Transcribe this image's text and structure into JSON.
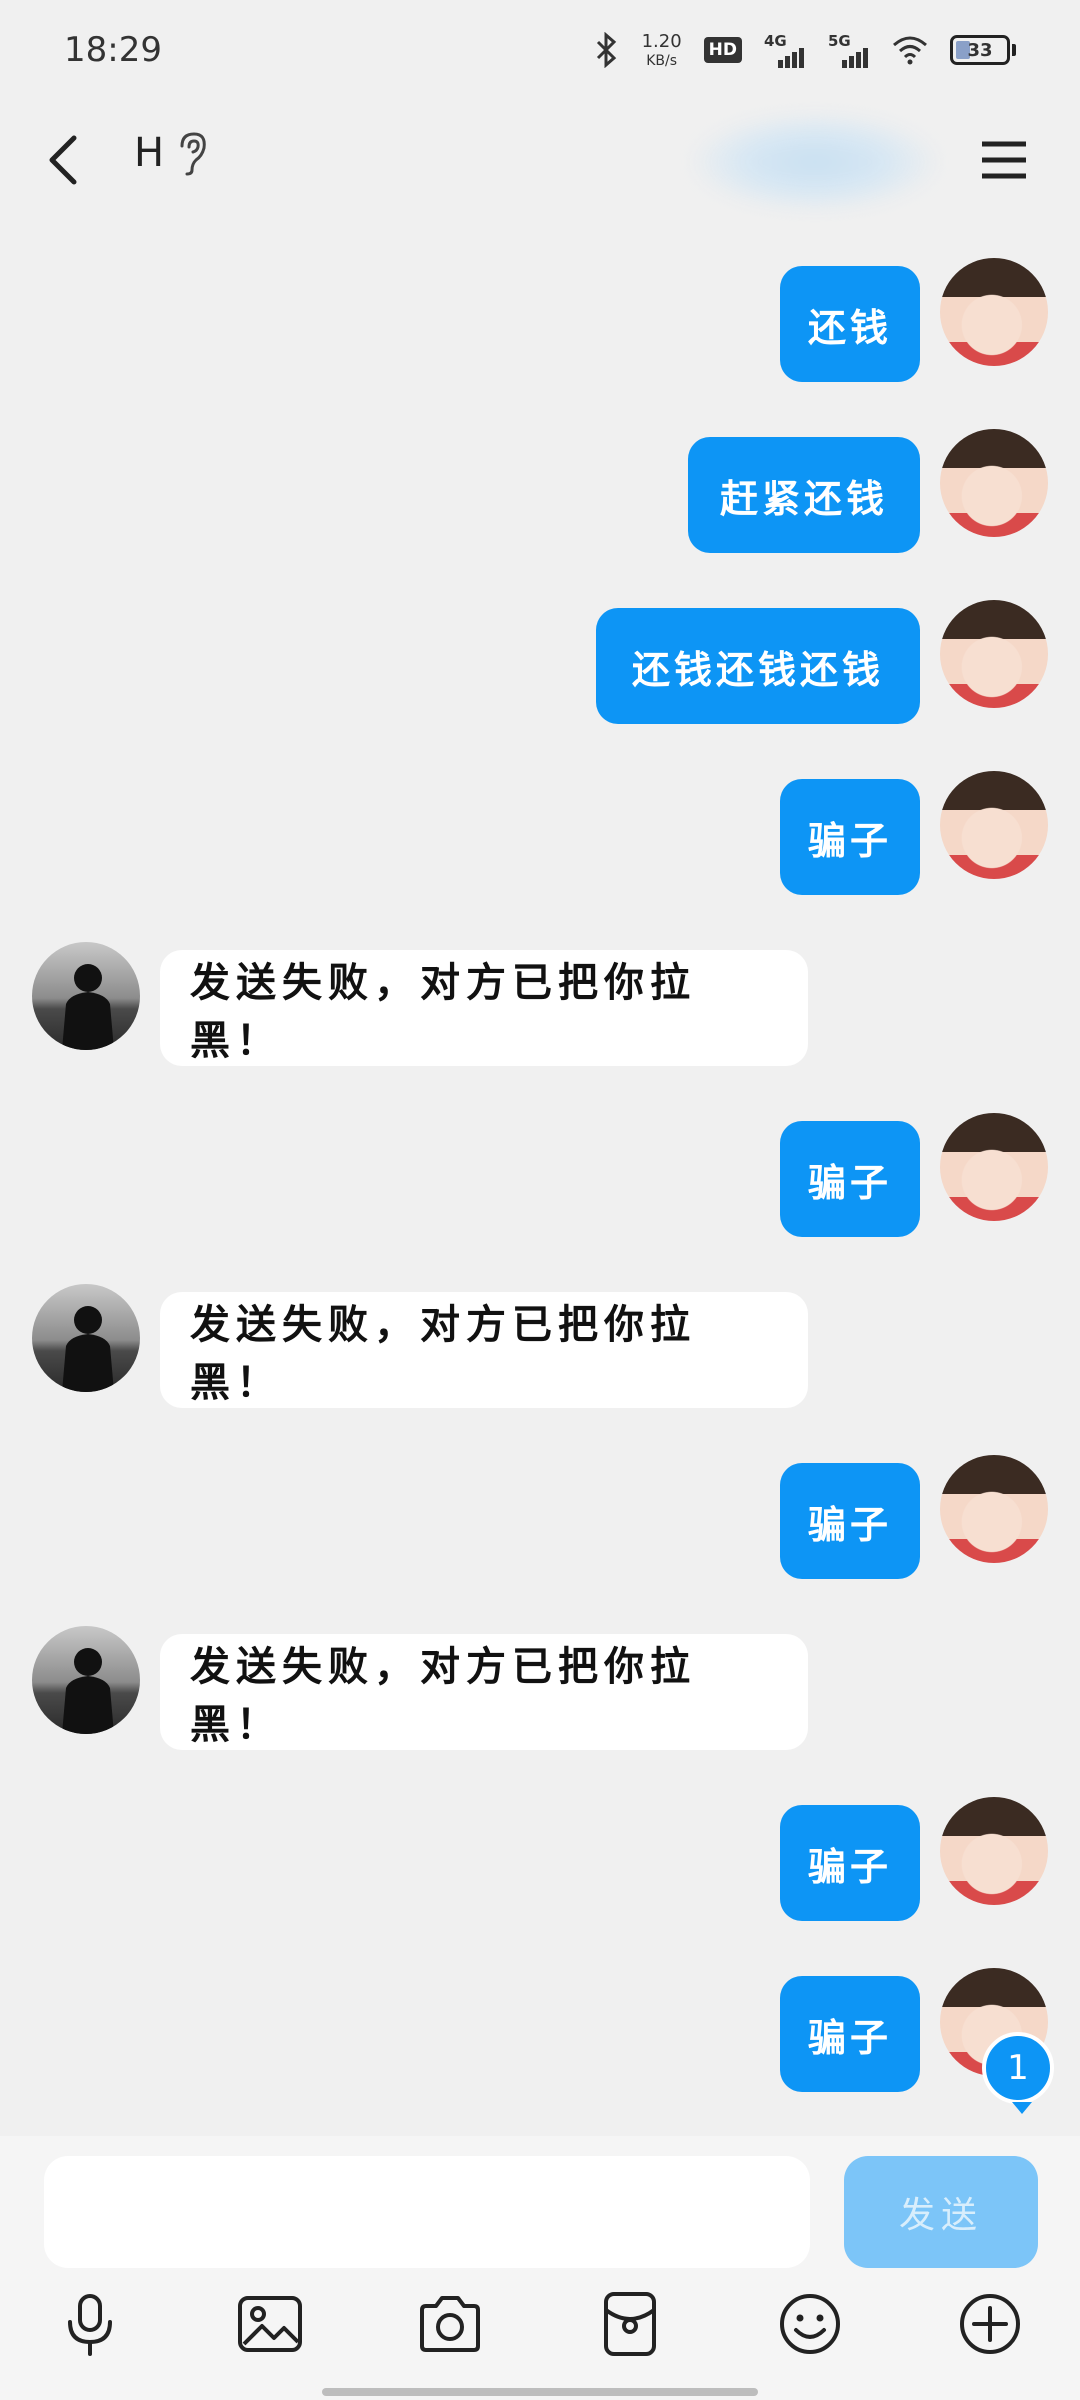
{
  "status_bar": {
    "time": "18:29",
    "net_speed_value": "1.20",
    "net_speed_unit": "KB/s",
    "hd_label": "HD",
    "sig1_label": "4G",
    "sig2_label": "5G",
    "battery": "33"
  },
  "header": {
    "chat_name": "H"
  },
  "messages": [
    {
      "sender": "me",
      "text": "还钱"
    },
    {
      "sender": "me",
      "text": "赶紧还钱"
    },
    {
      "sender": "me",
      "text": "还钱还钱还钱"
    },
    {
      "sender": "me",
      "text": "骗子"
    },
    {
      "sender": "other",
      "text": "发送失败，对方已把你拉黑！"
    },
    {
      "sender": "me",
      "text": "骗子"
    },
    {
      "sender": "other",
      "text": "发送失败，对方已把你拉黑！"
    },
    {
      "sender": "me",
      "text": "骗子"
    },
    {
      "sender": "other",
      "text": "发送失败，对方已把你拉黑！"
    },
    {
      "sender": "me",
      "text": "骗子"
    },
    {
      "sender": "me",
      "text": "骗子"
    }
  ],
  "unread_count": "1",
  "composer": {
    "placeholder": "",
    "send_label": "发送"
  },
  "toolbar": [
    "microphone-icon",
    "image-icon",
    "camera-icon",
    "red-packet-icon",
    "emoji-icon",
    "plus-icon"
  ],
  "colors": {
    "accent": "#0d95f5",
    "background": "#f0f0f0",
    "send_disabled": "#7cc5f8"
  }
}
